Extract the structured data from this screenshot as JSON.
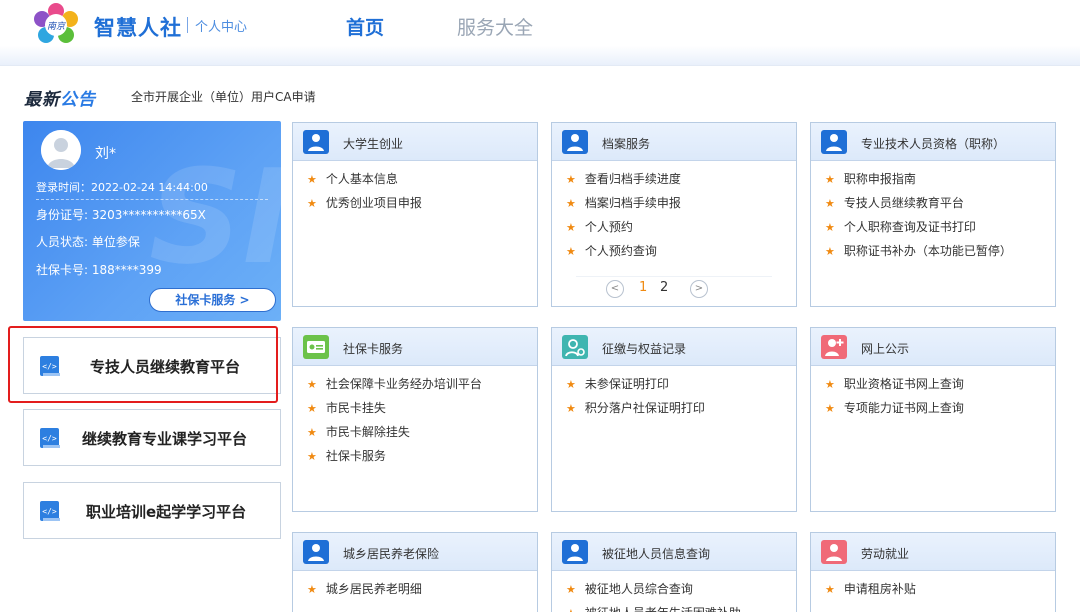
{
  "header": {
    "brand": "智慧人社",
    "sub": "个人中心",
    "nav": {
      "home": "首页",
      "services": "服务大全"
    }
  },
  "notice": {
    "title_a": "最新",
    "title_b": "公告",
    "text": "全市开展企业（单位）用户CA申请"
  },
  "user": {
    "name": "刘*",
    "login_time": "登录时间：2022-02-24 14:44:00",
    "id_number": "身份证号: 3203**********65X",
    "status": "人员状态: 单位参保",
    "card_number": "社保卡号: 188****399",
    "card_service_button": "社保卡服务 >"
  },
  "platforms": [
    {
      "label": "专技人员继续教育平台"
    },
    {
      "label": "继续教育专业课学习平台"
    },
    {
      "label": "职业培训e起学学习平台"
    }
  ],
  "cards": [
    {
      "title": "大学生创业",
      "icon": "person-icon",
      "color": "#1f6fd6",
      "items": [
        "个人基本信息",
        "优秀创业项目申报"
      ]
    },
    {
      "title": "档案服务",
      "icon": "person-icon",
      "color": "#1f6fd6",
      "items": [
        "查看归档手续进度",
        "档案归档手续申报",
        "个人预约",
        "个人预约查询"
      ],
      "pager": {
        "prev": "<",
        "page1": "1",
        "page2": "2",
        "next": ">"
      }
    },
    {
      "title": "专业技术人员资格（职称）",
      "icon": "person-icon",
      "color": "#1f6fd6",
      "items": [
        "职称申报指南",
        "专技人员继续教育平台",
        "个人职称查询及证书打印",
        "职称证书补办（本功能已暂停）"
      ]
    },
    {
      "title": "社保卡服务",
      "icon": "id-card-icon",
      "color": "#6cc24a",
      "items": [
        "社会保障卡业务经办培训平台",
        "市民卡挂失",
        "市民卡解除挂失",
        "社保卡服务"
      ]
    },
    {
      "title": "征缴与权益记录",
      "icon": "person-gear-icon",
      "color": "#3fb5b0",
      "items": [
        "未参保证明打印",
        "积分落户社保证明打印"
      ]
    },
    {
      "title": "网上公示",
      "icon": "person-plus-icon",
      "color": "#f06a78",
      "items": [
        "职业资格证书网上查询",
        "专项能力证书网上查询"
      ]
    },
    {
      "title": "城乡居民养老保险",
      "icon": "person-icon",
      "color": "#1f6fd6",
      "items": [
        "城乡居民养老明细"
      ]
    },
    {
      "title": "被征地人员信息查询",
      "icon": "person-icon",
      "color": "#1f6fd6",
      "items": [
        "被征地人员综合查询",
        "被征地人员老年生活困难补助"
      ]
    },
    {
      "title": "劳动就业",
      "icon": "person-icon",
      "color": "#f06a78",
      "items": [
        "申请租房补贴"
      ]
    }
  ]
}
